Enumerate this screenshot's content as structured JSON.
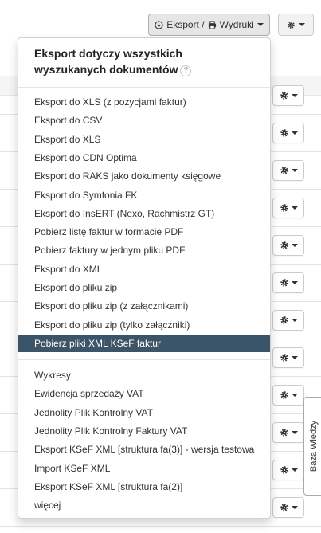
{
  "toolbar": {
    "export_label": "Eksport / ",
    "print_label": "Wydruki"
  },
  "dropdown": {
    "header_line1": "Eksport dotyczy wszystkich",
    "header_line2": "wyszukanych dokumentów",
    "help_symbol": "?",
    "export_items": [
      "Eksport do XLS (z pozycjami faktur)",
      "Eksport do CSV",
      "Eksport do XLS",
      "Eksport do CDN Optima",
      "Eksport do RAKS jako dokumenty księgowe",
      "Eksport do Symfonia FK",
      "Eksport do InsERT (Nexo, Rachmistrz GT)",
      "Pobierz listę faktur w formacie PDF",
      "Pobierz faktury w jednym pliku PDF",
      "Eksport do XML",
      "Eksport do pliku zip",
      "Eksport do pliku zip (z załącznikami)",
      "Eksport do pliku zip (tylko załączniki)",
      "Pobierz pliki XML KSeF faktur"
    ],
    "report_items": [
      "Wykresy",
      "Ewidencja sprzedaży VAT",
      "Jednolity Plik Kontrolny VAT",
      "Jednolity Plik Kontrolny Faktury VAT",
      "Eksport KSeF XML [struktura fa(3)] - wersja testowa",
      "Import KSeF XML",
      "Eksport KSeF XML [struktura fa(2)]",
      "więcej"
    ],
    "active_item": "Pobierz pliki XML KSeF faktur"
  },
  "side_tab": {
    "label": "Baza Wiedzy"
  },
  "colors": {
    "active_bg": "#3c5468",
    "active_text": "#ffffff"
  }
}
